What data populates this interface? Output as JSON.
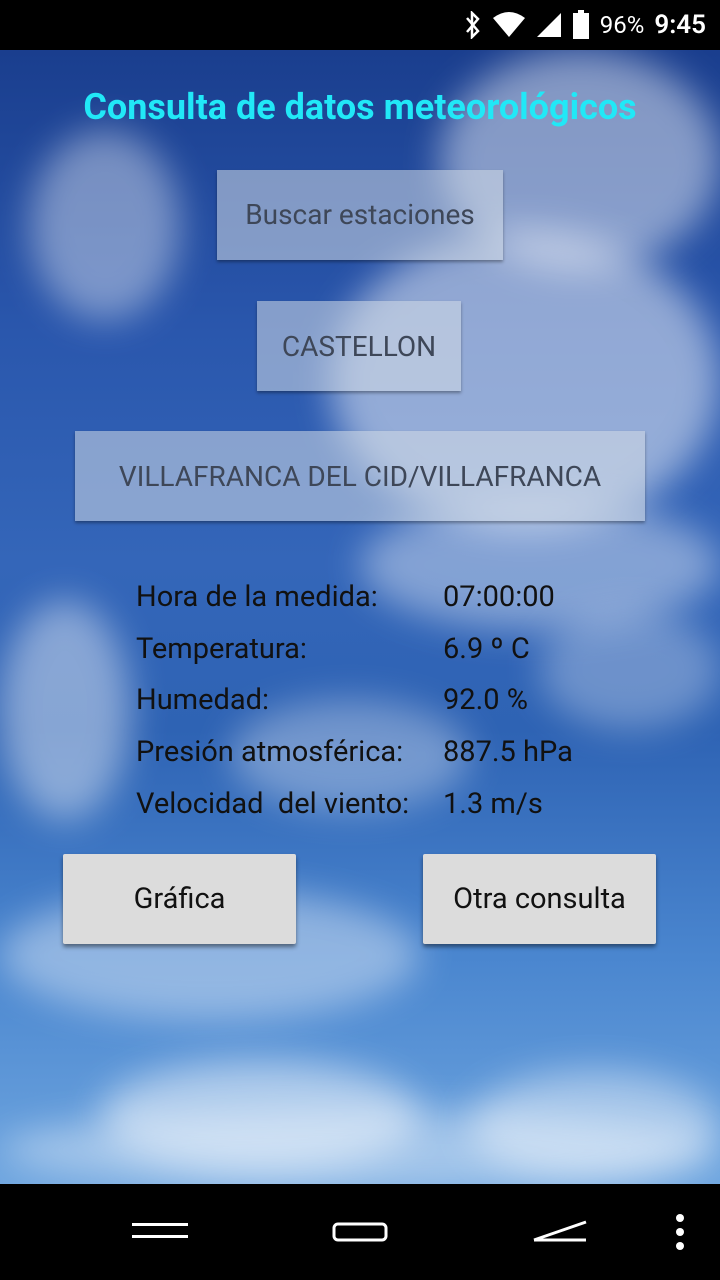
{
  "status_bar": {
    "battery": "96%",
    "time": "9:45"
  },
  "app": {
    "title": "Consulta de datos meteorológicos",
    "search_button": "Buscar estaciones",
    "province_button": "CASTELLON",
    "station_button": "VILLAFRANCA DEL CID/VILLAFRANCA"
  },
  "measurements": [
    {
      "label": "Hora de la medida:",
      "value": "07:00:00"
    },
    {
      "label": "Temperatura:",
      "value": "6.9 º C"
    },
    {
      "label": "Humedad:",
      "value": "92.0 %"
    },
    {
      "label": "Presión atmosférica:",
      "value": "887.5 hPa"
    },
    {
      "label": "Velocidad  del viento:",
      "value": "1.3 m/s"
    }
  ],
  "actions": {
    "chart_button": "Gráfica",
    "new_query_button": "Otra consulta"
  },
  "icons": {
    "status": [
      "bluetooth-icon",
      "wifi-icon",
      "signal-icon",
      "battery-icon"
    ],
    "nav": [
      "recents-icon",
      "home-icon",
      "back-icon",
      "overflow-menu-icon"
    ]
  }
}
